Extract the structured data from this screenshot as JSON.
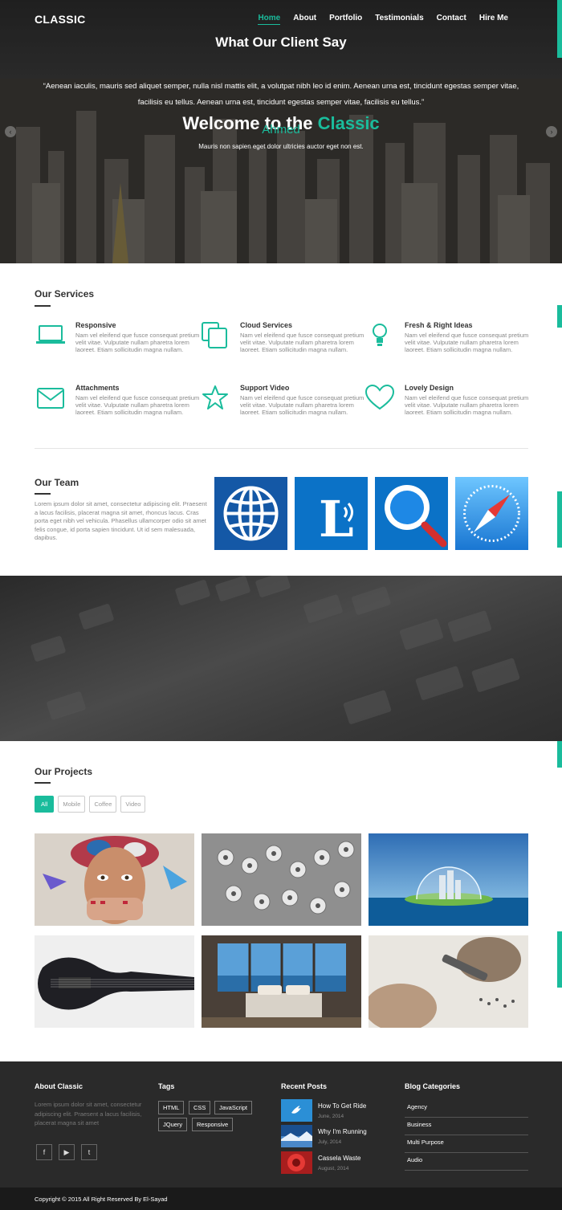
{
  "header": {
    "brand": "CLASSIC",
    "nav": [
      "Home",
      "About",
      "Portfolio",
      "Testimonials",
      "Contact",
      "Hire Me"
    ],
    "active_nav": "Home"
  },
  "hero": {
    "title_prefix": "Welcome to the ",
    "title_accent": "Classic",
    "subtitle": "Mauris non sapien eget dolor ultricies auctor eget non est.",
    "prev_icon": "chevron-left-icon",
    "next_icon": "chevron-right-icon"
  },
  "services": {
    "title": "Our Services",
    "items": [
      {
        "icon": "laptop-icon",
        "name": "Responsive",
        "text": "Nam vel eleifend que fusce consequat pretium velit vitae. Vulputate nullam pharetra lorem laoreet. Etiam sollicitudin magna nullam."
      },
      {
        "icon": "copy-icon",
        "name": "Cloud Services",
        "text": "Nam vel eleifend que fusce consequat pretium velit vitae. Vulputate nullam pharetra lorem laoreet. Etiam sollicitudin magna nullam."
      },
      {
        "icon": "lightbulb-icon",
        "name": "Fresh & Right Ideas",
        "text": "Nam vel eleifend que fusce consequat pretium velit vitae. Vulputate nullam pharetra lorem laoreet. Etiam sollicitudin magna nullam."
      },
      {
        "icon": "envelope-icon",
        "name": "Attachments",
        "text": "Nam vel eleifend que fusce consequat pretium velit vitae. Vulputate nullam pharetra lorem laoreet. Etiam sollicitudin magna nullam."
      },
      {
        "icon": "star-icon",
        "name": "Support Video",
        "text": "Nam vel eleifend que fusce consequat pretium velit vitae. Vulputate nullam pharetra lorem laoreet. Etiam sollicitudin magna nullam."
      },
      {
        "icon": "heart-icon",
        "name": "Lovely Design",
        "text": "Nam vel eleifend que fusce consequat pretium velit vitae. Vulputate nullam pharetra lorem laoreet. Etiam sollicitudin magna nullam."
      }
    ]
  },
  "team": {
    "title": "Our Team",
    "text": "Lorem ipsum dolor sit amet, consectetur adipiscing elit. Praesent a lacus facilisis, placerat magna sit amet, rhoncus lacus. Cras porta eget nibh vel vehicula. Phasellus ullamcorper odio sit amet felis congue, id porta sapien tincidunt. Ut id sem malesuada, dapibus.",
    "tiles": [
      "globe-icon",
      "letter-l-icon",
      "search-icon",
      "compass-icon"
    ]
  },
  "testimonials": {
    "title": "What Our Client Say",
    "quote": "“Aenean iaculis, mauris sed aliquet semper, nulla nisl mattis elit, a volutpat nibh leo id enim. Aenean urna est, tincidunt egestas semper vitae, facilisis eu tellus. Aenean urna est, tincidunt egestas semper vitae, facilisis eu tellus.”",
    "author": "Ahmed"
  },
  "projects": {
    "title": "Our Projects",
    "filters": [
      "All",
      "Mobile",
      "Coffee",
      "Video"
    ],
    "active_filter": "All",
    "items": [
      "painted-face-image",
      "paper-rolls-image",
      "island-dome-image",
      "bass-guitar-image",
      "bedroom-view-image",
      "hands-tool-image"
    ]
  },
  "footer": {
    "about_title": "About Classic",
    "about_text": "Lorem ipsum dolor sit amet, consectetur adipiscing elit. Praesent a lacus facilisis, placerat magna sit amet",
    "social": [
      "facebook-icon",
      "youtube-icon",
      "twitter-icon"
    ],
    "tags_title": "Tags",
    "tags": [
      "HTML",
      "CSS",
      "JavaScript",
      "JQuery",
      "Responsive"
    ],
    "posts_title": "Recent Posts",
    "posts": [
      {
        "title": "How To Get Ride",
        "date": "June, 2014"
      },
      {
        "title": "Why I'm Running",
        "date": "July, 2014"
      },
      {
        "title": "Cassela Waste",
        "date": "August, 2014"
      }
    ],
    "categories_title": "Blog Categories",
    "categories": [
      "Agency",
      "Business",
      "Multi Purpose",
      "Audio"
    ],
    "copyright": "Copyright © 2015 All Right Reserved By El-Sayad"
  },
  "colors": {
    "accent": "#1abc9c",
    "dark": "#2a2a2a",
    "footer_bottom": "#1a1a1a"
  }
}
